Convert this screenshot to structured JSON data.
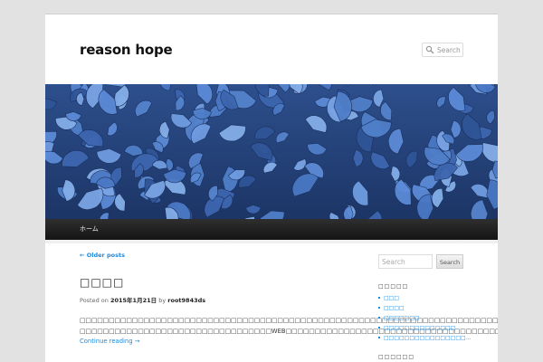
{
  "header": {
    "site_title": "reason hope",
    "search_placeholder": "Search"
  },
  "menu": {
    "items": [
      "ホーム"
    ]
  },
  "content": {
    "older_posts": "← Older posts",
    "post_title": "□□□□",
    "meta_prefix": "Posted on",
    "meta_date": "2015年1月21日",
    "meta_by": "by",
    "meta_author": "root9843ds",
    "paragraph1": "□□□□□□□□□□□□□□□□□□□□□□□□□□□□□□□□□□□□□□□□□□□□□□□□□□□□□□□□□□□□□□□□□□□□□□□□□□□□□□□□□□□",
    "paragraph2": "□□□□□□□□□□□□□□□□□□□□□□□□□□□□□□□□□WEB□□□□□□□□□□□□□□□□□□□□□□□□□□□□□□□□□□□□□□□□□□□□□□□□",
    "continue_reading": "Continue reading →"
  },
  "sidebar": {
    "search_placeholder": "Search",
    "search_button": "Search",
    "widget1_title": "□□□□□",
    "widget1_items": [
      "□□□",
      "□□□□",
      "□□□□□□□",
      "□□□□□□□□□□□□□□",
      "□□□□□□□□□□□□□□□□…"
    ],
    "widget2_title": "□□□□□□"
  },
  "colors": {
    "link": "#1b8be0",
    "nav_bar": "#222222",
    "background": "#e2e2e2"
  }
}
